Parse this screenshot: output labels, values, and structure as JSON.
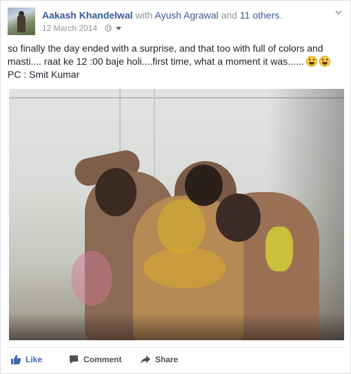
{
  "post": {
    "author": "Aakash Khandelwal",
    "with_text": " with ",
    "tagged_person": "Ayush Agrawal",
    "and_text": " and ",
    "others": "11 others",
    "period": ".",
    "date": "12 March 2014",
    "separator": "·",
    "privacy_icon": "globe-icon",
    "text_line1": "so finally the day ended with a surprise, and that too with full of colors and masti.... raat ke 12 :00 baje holi....first time, what a moment it was......",
    "text_line2": "PC : Smit Kumar",
    "emoji_count": 2
  },
  "actions": {
    "like": "Like",
    "comment": "Comment",
    "share": "Share"
  },
  "colors": {
    "link": "#365899",
    "like_blue": "#4267b2",
    "meta_gray": "#90949c"
  }
}
